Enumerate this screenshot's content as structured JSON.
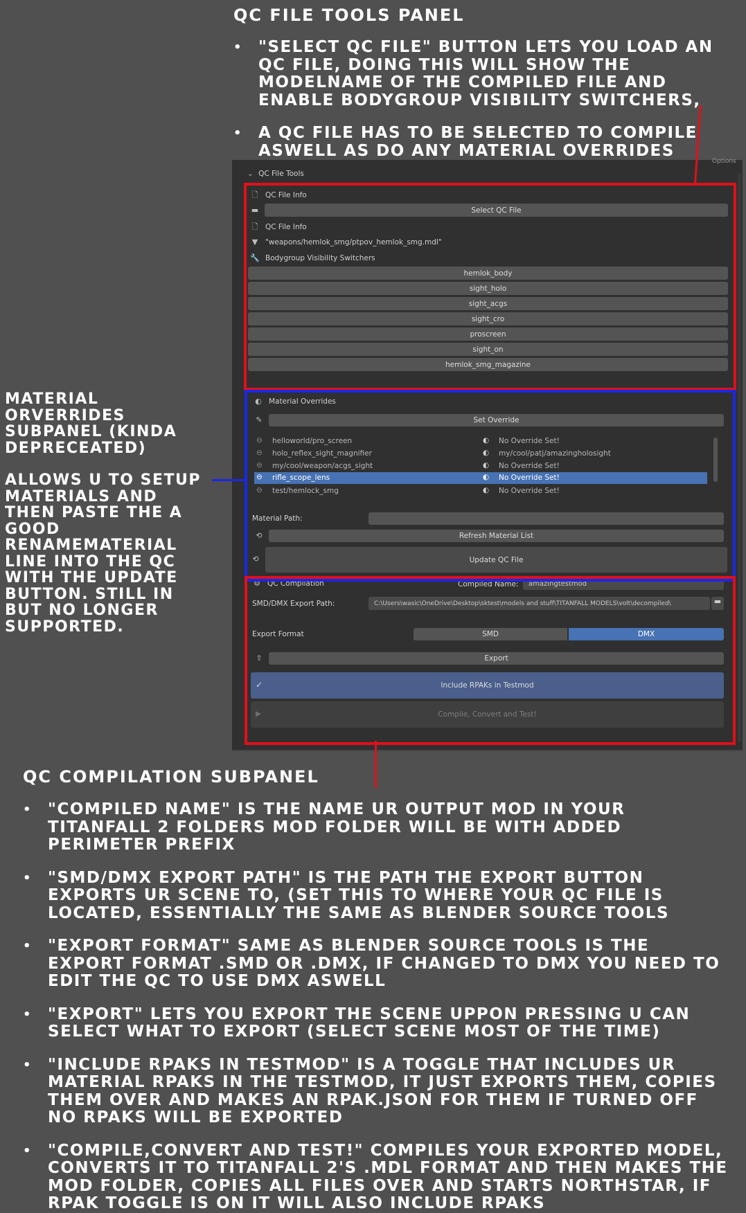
{
  "top": {
    "heading": "QC FILE TOOLS PANEL",
    "bullets": [
      "\"SELECT QC FILE\" BUTTON LETS YOU LOAD AN QC FILE, DOING THIS WILL SHOW THE MODELNAME OF THE COMPILED FILE AND ENABLE BODYGROUP VISIBILITY SWITCHERS,",
      "A QC FILE HAS TO BE SELECTED TO COMPILE ASWELL AS DO ANY MATERIAL OVERRIDES"
    ]
  },
  "left_note": {
    "title": "MATERIAL ORVERRIDES SUBPANEL (KINDA DEPRECEATED)",
    "body": "ALLOWS U TO SETUP MATERIALS AND THEN PASTE THE A GOOD RENAMEMATERIAL LINE INTO THE QC WITH THE UPDATE BUTTON. STILL IN BUT NO LONGER SUPPORTED."
  },
  "panel": {
    "options_label": "Options",
    "panel_title": "QC File Tools",
    "qc_info_label_1": "QC File Info",
    "select_qc_button": "Select QC File",
    "qc_info_label_2": "QC File Info",
    "model_path": "\"weapons/hemlok_smg/ptpov_hemlok_smg.mdl\"",
    "bodygroup_label": "Bodygroup Visibility Switchers",
    "bodygroups": [
      "hemlok_body",
      "sight_holo",
      "sight_acgs",
      "sight_cro",
      "proscreen",
      "sight_on",
      "hemlok_smg_magazine"
    ],
    "material_overrides_title": "Material Overrides",
    "set_override_button": "Set Override",
    "materials": [
      {
        "name": "helloworld/pro_screen",
        "override": "No Override Set!",
        "selected": false
      },
      {
        "name": "holo_reflex_sight_magnifier",
        "override": "my/cool/patj/amazingholosight",
        "selected": false
      },
      {
        "name": "my/cool/weapon/acgs_sight",
        "override": "No Override Set!",
        "selected": false
      },
      {
        "name": "rifle_scope_lens",
        "override": "No Override Set!",
        "selected": true
      },
      {
        "name": "test/hemlock_smg",
        "override": "No Override Set!",
        "selected": false
      }
    ],
    "material_path_label": "Material Path:",
    "refresh_button": "Refresh Material List",
    "update_qc_button": "Update QC File",
    "compilation_title": "QC Compilation",
    "compiled_name_label": "Compiled Name:",
    "compiled_name_value": "amazingtestmod",
    "export_path_label": "SMD/DMX Export Path:",
    "export_path_value": "C:\\Users\\wasic\\OneDrive\\Desktop\\sktest\\models and stuff\\TITANFALL MODELS\\volt\\decompiled\\",
    "export_format_label": "Export Format",
    "format_options": [
      "SMD",
      "DMX"
    ],
    "format_selected": "DMX",
    "export_button": "Export",
    "include_rpaks_label": "Include RPAKs in Testmod",
    "include_rpaks_checked": true,
    "compile_button": "Compile, Convert and Test!",
    "colors": {
      "red_outline": "#e0101a",
      "blue_outline": "#1a28e6",
      "active_blue": "#4772b3"
    }
  },
  "bottom": {
    "heading": "QC COMPILATION SUBPANEL",
    "bullets": [
      "\"COMPILED NAME\" IS THE NAME UR OUTPUT MOD IN YOUR TITANFALL 2 FOLDERS MOD FOLDER WILL BE WITH ADDED PERIMETER PREFIX",
      "\"SMD/DMX EXPORT PATH\" IS THE PATH THE EXPORT BUTTON EXPORTS UR SCENE TO, (SET THIS TO WHERE YOUR QC FILE IS LOCATED, ESSENTIALLY THE SAME AS BLENDER SOURCE TOOLS",
      "\"EXPORT FORMAT\" SAME AS BLENDER SOURCE TOOLS IS THE EXPORT FORMAT .SMD OR .DMX, IF CHANGED TO DMX YOU NEED TO EDIT THE QC TO USE DMX ASWELL",
      "\"EXPORT\" LETS YOU EXPORT THE SCENE UPPON PRESSING U CAN SELECT WHAT TO EXPORT (SELECT SCENE MOST OF THE TIME)",
      "\"INCLUDE RPAKS IN TESTMOD\" IS A TOGGLE THAT INCLUDES UR MATERIAL RPAKS IN THE TESTMOD, IT JUST EXPORTS THEM, COPIES THEM OVER AND MAKES AN RPAK.JSON FOR THEM IF TURNED OFF NO RPAKS WILL BE EXPORTED",
      "\"COMPILE,CONVERT AND TEST!\" COMPILES YOUR EXPORTED MODEL, CONVERTS IT TO TITANFALL 2'S .MDL FORMAT AND THEN MAKES THE MOD FOLDER, COPIES ALL FILES OVER AND STARTS NORTHSTAR, IF RPAK TOGGLE IS ON IT WILL ALSO INCLUDE RPAKS"
    ]
  }
}
